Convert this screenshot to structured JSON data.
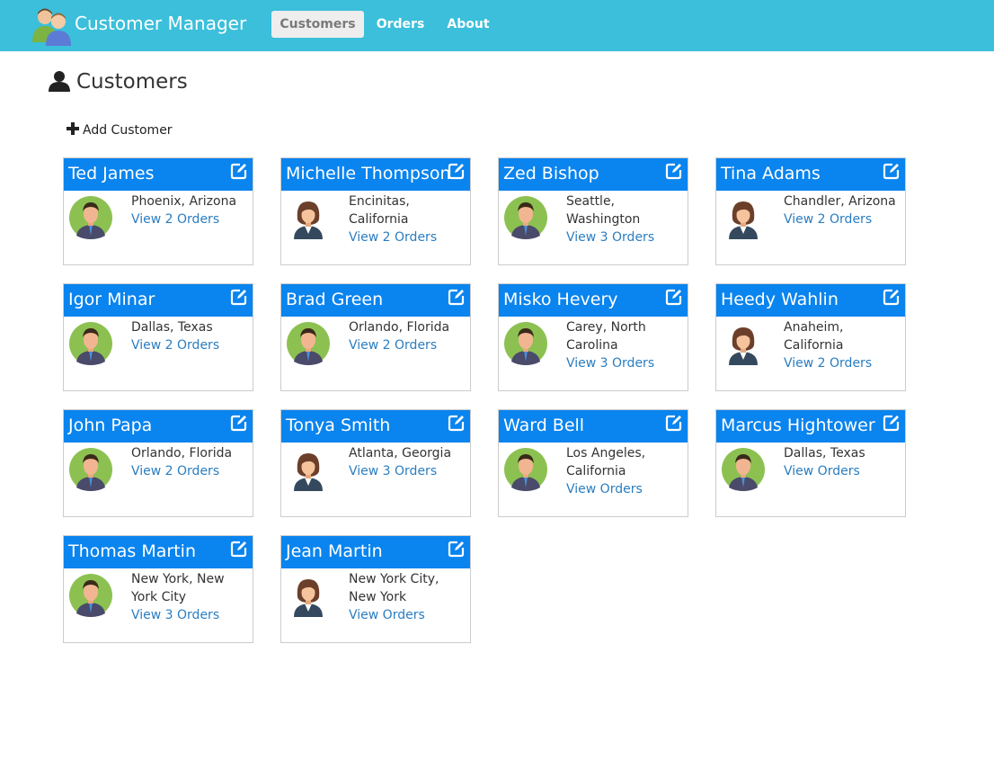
{
  "app": {
    "title": "Customer Manager"
  },
  "nav": {
    "items": [
      {
        "label": "Customers",
        "active": true
      },
      {
        "label": "Orders",
        "active": false
      },
      {
        "label": "About",
        "active": false
      }
    ]
  },
  "page": {
    "title": "Customers",
    "icon": "user-icon"
  },
  "actions": {
    "add_label": "Add Customer"
  },
  "colors": {
    "navbar": "#3bbfdb",
    "card_header": "#0a84ee",
    "link": "#2a7dc1"
  },
  "customers": [
    {
      "name": "Ted James",
      "location": "Phoenix, Arizona",
      "orders": "View 2 Orders",
      "avatar": "male-avatar"
    },
    {
      "name": "Michelle Thompson",
      "location": "Encinitas, California",
      "orders": "View 2 Orders",
      "avatar": "female-avatar"
    },
    {
      "name": "Zed Bishop",
      "location": "Seattle, Washington",
      "orders": "View 3 Orders",
      "avatar": "male-avatar"
    },
    {
      "name": "Tina Adams",
      "location": "Chandler, Arizona",
      "orders": "View 2 Orders",
      "avatar": "female-avatar"
    },
    {
      "name": "Igor Minar",
      "location": "Dallas, Texas",
      "orders": "View 2 Orders",
      "avatar": "male-avatar"
    },
    {
      "name": "Brad Green",
      "location": "Orlando, Florida",
      "orders": "View 2 Orders",
      "avatar": "male-avatar"
    },
    {
      "name": "Misko Hevery",
      "location": "Carey, North Carolina",
      "orders": "View 3 Orders",
      "avatar": "male-avatar"
    },
    {
      "name": "Heedy Wahlin",
      "location": "Anaheim, California",
      "orders": "View 2 Orders",
      "avatar": "female-avatar"
    },
    {
      "name": "John Papa",
      "location": "Orlando, Florida",
      "orders": "View 2 Orders",
      "avatar": "male-avatar"
    },
    {
      "name": "Tonya Smith",
      "location": "Atlanta, Georgia",
      "orders": "View 3 Orders",
      "avatar": "female-avatar"
    },
    {
      "name": "Ward Bell",
      "location": "Los Angeles, California",
      "orders": "View Orders",
      "avatar": "male-avatar"
    },
    {
      "name": "Marcus Hightower",
      "location": "Dallas, Texas",
      "orders": "View Orders",
      "avatar": "male-avatar"
    },
    {
      "name": "Thomas Martin",
      "location": "New York, New York City",
      "orders": "View 3 Orders",
      "avatar": "male-avatar"
    },
    {
      "name": "Jean Martin",
      "location": "New York City, New York",
      "orders": "View Orders",
      "avatar": "female-avatar"
    }
  ]
}
